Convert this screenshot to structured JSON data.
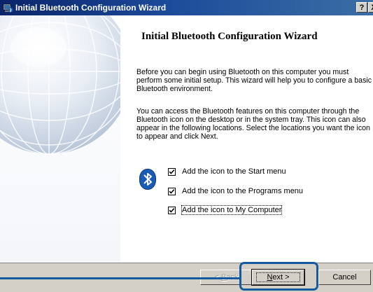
{
  "window": {
    "title": "Initial Bluetooth Configuration Wizard",
    "help_label": "?",
    "close_label": "X",
    "icon": "bluetooth-computer-icon"
  },
  "wizard": {
    "heading": "Initial Bluetooth Configuration Wizard",
    "paragraph1": "Before you can begin using Bluetooth on this computer you must perform some initial setup. This wizard will help you to configure a basic Bluetooth environment.",
    "paragraph2": "You can access the Bluetooth features on this computer through the Bluetooth icon on the desktop or in the system tray. This icon can also appear in the following locations. Select the locations you want the icon to appear and click Next.",
    "logo_icon": "bluetooth-icon",
    "options": [
      {
        "label": "Add the icon to the Start menu",
        "checked": true
      },
      {
        "label": "Add the icon to the Programs menu",
        "checked": true
      },
      {
        "label": "Add the icon to My Computer",
        "checked": true
      }
    ]
  },
  "buttons": {
    "back": {
      "label_underlined": "B",
      "label_rest": "ack",
      "prefix": "< ",
      "enabled": false
    },
    "next": {
      "label_underlined": "N",
      "label_rest": "ext >"
    },
    "cancel": {
      "label": "Cancel"
    }
  },
  "colors": {
    "titlebar_start": "#0a246a",
    "titlebar_end": "#3a6ea5",
    "dialog_face": "#d4d0c8",
    "callout": "#155a9e",
    "bluetooth_blue": "#1a5bb5"
  }
}
